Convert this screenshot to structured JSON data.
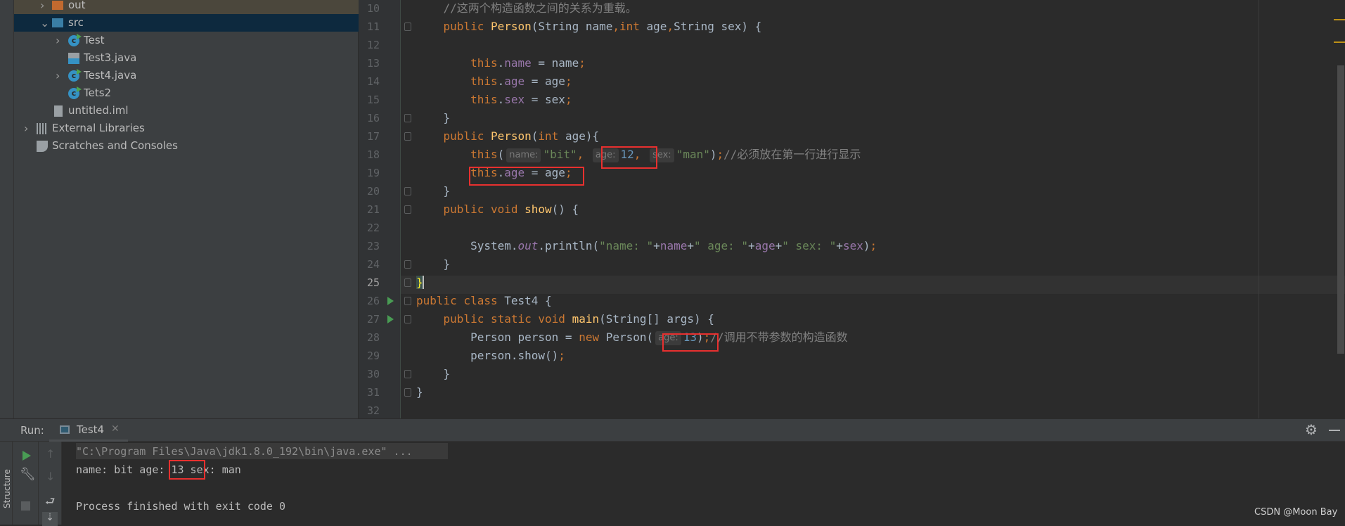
{
  "project_tree": [
    {
      "label": "out",
      "icon": "folder-orange-icon",
      "expanded": false
    },
    {
      "label": "src",
      "icon": "folder-blue-icon",
      "expanded": true,
      "selected": true
    },
    {
      "label": "Test",
      "icon": "java-class-runnable-icon",
      "expanded": false
    },
    {
      "label": "Test3.java",
      "icon": "java-file-icon"
    },
    {
      "label": "Test4.java",
      "icon": "java-class-runnable-icon",
      "expanded": false
    },
    {
      "label": "Tets2",
      "icon": "java-class-runnable-icon"
    },
    {
      "label": "untitled.iml",
      "icon": "iml-file-icon"
    },
    {
      "label": "External Libraries",
      "icon": "libraries-icon",
      "expanded": false
    },
    {
      "label": "Scratches and Consoles",
      "icon": "scratches-icon"
    }
  ],
  "editor": {
    "current_line": "25",
    "lines": [
      {
        "n": "10",
        "t": [
          [
            "    ",
            ""
          ],
          [
            "//这两个构造函数之间的关系为重载。",
            "cm"
          ]
        ]
      },
      {
        "n": "11",
        "t": [
          [
            "    ",
            ""
          ],
          [
            "public ",
            "kw"
          ],
          [
            "Person",
            "fn"
          ],
          [
            "(String name",
            ""
          ],
          [
            ",",
            "kw"
          ],
          [
            "int ",
            "kw"
          ],
          [
            "age",
            ""
          ],
          [
            ",",
            "kw"
          ],
          [
            "String sex) {",
            ""
          ]
        ]
      },
      {
        "n": "12",
        "t": []
      },
      {
        "n": "13",
        "t": [
          [
            "        ",
            ""
          ],
          [
            "this",
            "kw"
          ],
          [
            ".",
            ""
          ],
          [
            "name",
            "fd"
          ],
          [
            " = name",
            ""
          ],
          [
            ";",
            "kw"
          ]
        ]
      },
      {
        "n": "14",
        "t": [
          [
            "        ",
            ""
          ],
          [
            "this",
            "kw"
          ],
          [
            ".",
            ""
          ],
          [
            "age",
            "fd"
          ],
          [
            " = age",
            ""
          ],
          [
            ";",
            "kw"
          ]
        ]
      },
      {
        "n": "15",
        "t": [
          [
            "        ",
            ""
          ],
          [
            "this",
            "kw"
          ],
          [
            ".",
            ""
          ],
          [
            "sex",
            "fd"
          ],
          [
            " = sex",
            ""
          ],
          [
            ";",
            "kw"
          ]
        ]
      },
      {
        "n": "16",
        "t": [
          [
            "    }",
            ""
          ]
        ]
      },
      {
        "n": "17",
        "t": [
          [
            "    ",
            ""
          ],
          [
            "public ",
            "kw"
          ],
          [
            "Person",
            "fn"
          ],
          [
            "(",
            ""
          ],
          [
            "int ",
            "kw"
          ],
          [
            "age){",
            ""
          ]
        ]
      },
      {
        "n": "18",
        "t": [
          [
            "        ",
            ""
          ],
          [
            "this",
            "kw"
          ],
          [
            "(",
            ""
          ],
          [
            "name:",
            "hint"
          ],
          [
            "\"bit\"",
            "st"
          ],
          [
            ", ",
            "kw"
          ],
          [
            "age:",
            "hint"
          ],
          [
            "12",
            "nm"
          ],
          [
            ", ",
            "kw"
          ],
          [
            "sex:",
            "hint"
          ],
          [
            "\"man\"",
            "st"
          ],
          [
            ")",
            ""
          ],
          [
            ";",
            "kw"
          ],
          [
            "//必须放在第一行进行显示",
            "cm"
          ]
        ]
      },
      {
        "n": "19",
        "t": [
          [
            "        ",
            ""
          ],
          [
            "this",
            "kw"
          ],
          [
            ".",
            ""
          ],
          [
            "age",
            "fd"
          ],
          [
            " = age",
            ""
          ],
          [
            ";",
            "kw"
          ]
        ]
      },
      {
        "n": "20",
        "t": [
          [
            "    }",
            ""
          ]
        ]
      },
      {
        "n": "21",
        "t": [
          [
            "    ",
            ""
          ],
          [
            "public void ",
            "kw"
          ],
          [
            "show",
            "fn"
          ],
          [
            "() {",
            ""
          ]
        ]
      },
      {
        "n": "22",
        "t": []
      },
      {
        "n": "23",
        "t": [
          [
            "        System.",
            ""
          ],
          [
            "out",
            "stf"
          ],
          [
            ".println(",
            ""
          ],
          [
            "\"name: \"",
            "st"
          ],
          [
            "+",
            ""
          ],
          [
            "name",
            "fd"
          ],
          [
            "+",
            ""
          ],
          [
            "\" age: \"",
            "st"
          ],
          [
            "+",
            ""
          ],
          [
            "age",
            "fd"
          ],
          [
            "+",
            ""
          ],
          [
            "\" sex: \"",
            "st"
          ],
          [
            "+",
            ""
          ],
          [
            "sex",
            "fd"
          ],
          [
            ")",
            ""
          ],
          [
            ";",
            "kw"
          ]
        ]
      },
      {
        "n": "24",
        "t": [
          [
            "    }",
            ""
          ]
        ]
      },
      {
        "n": "25",
        "t": [
          [
            "}",
            ""
          ]
        ]
      },
      {
        "n": "26",
        "t": [
          [
            "public class ",
            "kw"
          ],
          [
            "Test4 {",
            ""
          ]
        ],
        "run": true
      },
      {
        "n": "27",
        "t": [
          [
            "    ",
            ""
          ],
          [
            "public static void ",
            "kw"
          ],
          [
            "main",
            "fn"
          ],
          [
            "(String[] args) {",
            ""
          ]
        ],
        "run": true
      },
      {
        "n": "28",
        "t": [
          [
            "        Person person = ",
            ""
          ],
          [
            "new ",
            "kw"
          ],
          [
            "Person(",
            ""
          ],
          [
            "age:",
            "hint"
          ],
          [
            "13",
            "nm"
          ],
          [
            ")",
            ""
          ],
          [
            ";",
            "kw"
          ],
          [
            "//调用不带参数的构造函数",
            "cm"
          ]
        ]
      },
      {
        "n": "29",
        "t": [
          [
            "        person.show()",
            ""
          ],
          [
            ";",
            "kw"
          ]
        ]
      },
      {
        "n": "30",
        "t": [
          [
            "    }",
            ""
          ]
        ]
      },
      {
        "n": "31",
        "t": [
          [
            "}",
            ""
          ]
        ]
      },
      {
        "n": "32",
        "t": []
      }
    ]
  },
  "run_panel": {
    "label": "Run:",
    "tab": "Test4",
    "side_label": "Structure",
    "console": [
      "\"C:\\Program Files\\Java\\jdk1.8.0_192\\bin\\java.exe\" ...",
      "name: bit age: 13 sex: man",
      "",
      "Process finished with exit code 0"
    ]
  },
  "watermark": "CSDN @Moon Bay",
  "colors": {
    "keyword": "#cc7832",
    "method": "#ffc66d",
    "field": "#9876aa",
    "string": "#6a8759",
    "number": "#6897bb",
    "comment": "#808080",
    "annotation_box": "#e8302f"
  }
}
